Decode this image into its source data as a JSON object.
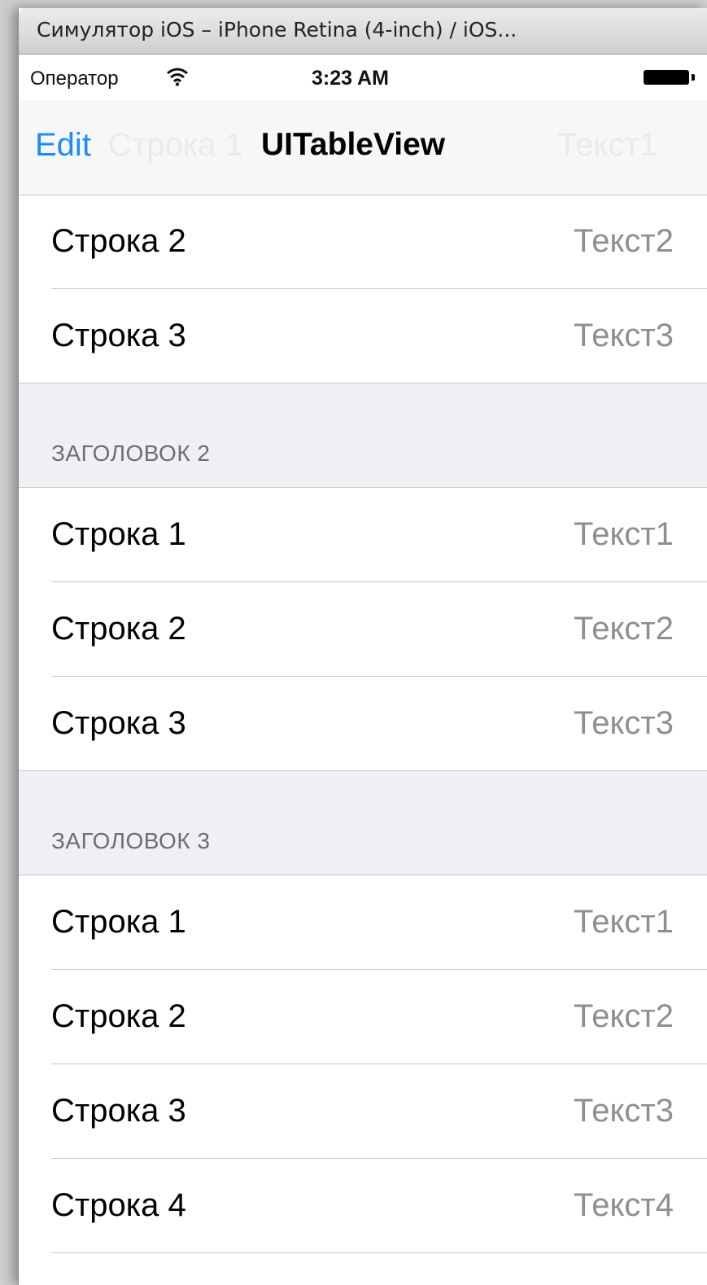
{
  "window": {
    "title": "Симулятор iOS – iPhone Retina (4-inch) / iOS..."
  },
  "status_bar": {
    "carrier": "Оператор",
    "time": "3:23 AM",
    "icons": [
      "wifi-icon",
      "battery-icon"
    ]
  },
  "nav_bar": {
    "edit_label": "Edit",
    "title": "UITableView",
    "ghost_row_title": "Строка 1",
    "ghost_row_detail": "Текст1"
  },
  "colors": {
    "tint": "#1a8cff",
    "detail_text": "#8e8e93",
    "section_background": "#efeff4",
    "separator": "#c8c7cc"
  },
  "table": {
    "section1": {
      "rows": [
        {
          "title": "Строка 2",
          "detail": "Текст2"
        },
        {
          "title": "Строка 3",
          "detail": "Текст3"
        }
      ]
    },
    "section2": {
      "header": "ЗАГОЛОВОК 2",
      "rows": [
        {
          "title": "Строка 1",
          "detail": "Текст1"
        },
        {
          "title": "Строка 2",
          "detail": "Текст2"
        },
        {
          "title": "Строка 3",
          "detail": "Текст3"
        }
      ]
    },
    "section3": {
      "header": "ЗАГОЛОВОК 3",
      "rows": [
        {
          "title": "Строка 1",
          "detail": "Текст1"
        },
        {
          "title": "Строка 2",
          "detail": "Текст2"
        },
        {
          "title": "Строка 3",
          "detail": "Текст3"
        },
        {
          "title": "Строка 4",
          "detail": "Текст4"
        }
      ]
    }
  }
}
